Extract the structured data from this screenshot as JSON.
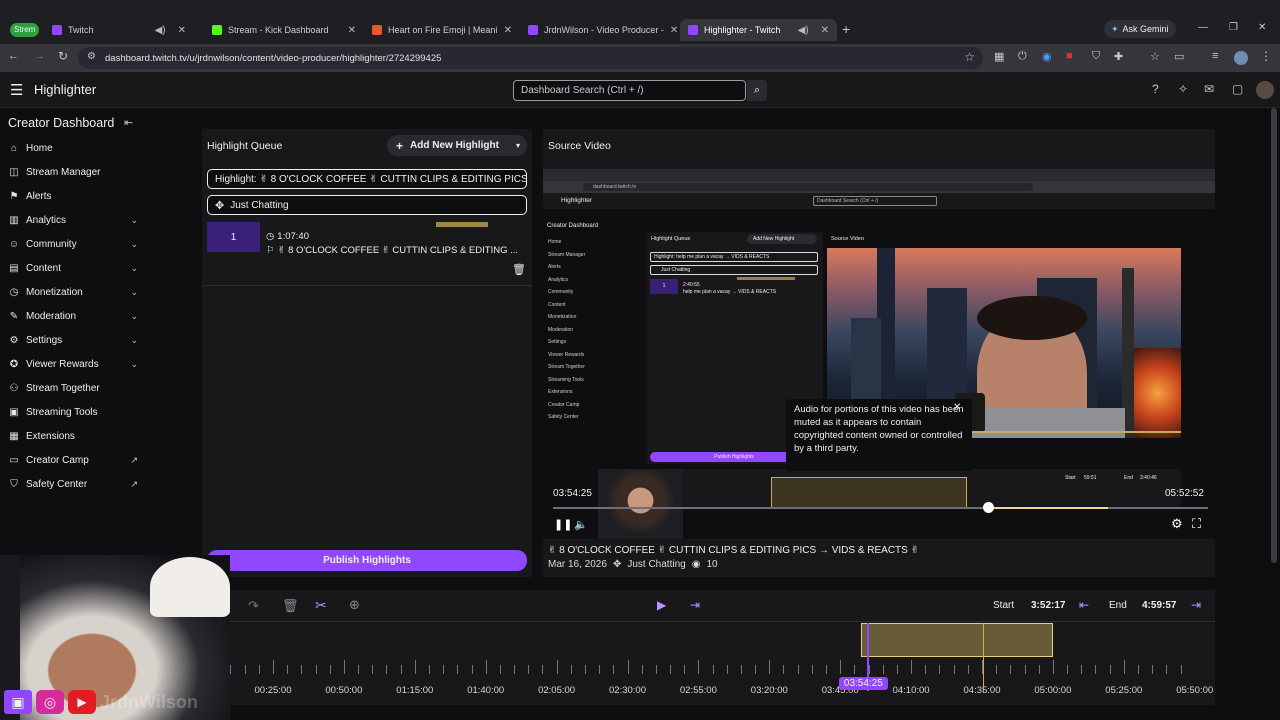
{
  "browser": {
    "profile_badge": "Strem",
    "tabs": [
      {
        "title": "Twitch",
        "color": "#9147ff"
      },
      {
        "title": "Stream - Kick Dashboard",
        "color": "#53fc18"
      },
      {
        "title": "Heart on Fire Emoji | Meani",
        "color": "#e55b2d"
      },
      {
        "title": "JrdnWilson - Video Producer -",
        "color": "#9147ff"
      },
      {
        "title": "Highlighter - Twitch",
        "color": "#9147ff"
      }
    ],
    "ask_gemini": "Ask Gemini",
    "url": "dashboard.twitch.tv/u/jrdnwilson/content/video-producer/highlighter/2724299425"
  },
  "header": {
    "title": "Highlighter",
    "search_placeholder": "Dashboard Search (Ctrl + /)"
  },
  "sidebar": {
    "title": "Creator Dashboard",
    "items": [
      {
        "label": "Home",
        "icon": "home-icon",
        "glyph": "⌂"
      },
      {
        "label": "Stream Manager",
        "icon": "stream-manager-icon",
        "glyph": "◫"
      },
      {
        "label": "Alerts",
        "icon": "alerts-icon",
        "glyph": "⚑"
      },
      {
        "label": "Analytics",
        "icon": "analytics-icon",
        "glyph": "▥"
      },
      {
        "label": "Community",
        "icon": "community-icon",
        "glyph": "☺"
      },
      {
        "label": "Content",
        "icon": "content-icon",
        "glyph": "▤"
      },
      {
        "label": "Monetization",
        "icon": "monetization-icon",
        "glyph": "◷"
      },
      {
        "label": "Moderation",
        "icon": "moderation-icon",
        "glyph": "✎"
      },
      {
        "label": "Settings",
        "icon": "settings-icon",
        "glyph": "⚙"
      },
      {
        "label": "Viewer Rewards",
        "icon": "rewards-icon",
        "glyph": "✪"
      },
      {
        "label": "Stream Together",
        "icon": "stream-together-icon",
        "glyph": "⚇"
      },
      {
        "label": "Streaming Tools",
        "icon": "streaming-tools-icon",
        "glyph": "▣"
      },
      {
        "label": "Extensions",
        "icon": "extensions-icon",
        "glyph": "▦"
      },
      {
        "label": "Creator Camp",
        "icon": "creator-camp-icon",
        "glyph": "▭"
      },
      {
        "label": "Safety Center",
        "icon": "safety-icon",
        "glyph": "⛉"
      }
    ]
  },
  "queue": {
    "title": "Highlight Queue",
    "add_label": "Add New Highlight",
    "highlight_title": "Highlight: ✌ 8 O'CLOCK COFFEE ✌ CUTTIN CLIPS & EDITING PICS →",
    "category": "Just Chatting",
    "item": {
      "index": "1",
      "duration": "1:07:40",
      "title": "✌ 8 O'CLOCK COFFEE ✌ CUTTIN CLIPS & EDITING ..."
    },
    "publish_label": "Publish Highlights"
  },
  "source": {
    "title": "Source Video",
    "time_current": "03:54:25",
    "time_end": "05:52:52",
    "muted_notice": "Audio for portions of this video has been muted as it appears to contain copyrighted content owned or controlled by a third party.",
    "video_title": "✌ 8 O'CLOCK COFFEE ✌ CUTTIN CLIPS & EDITING PICS → VIDS & REACTS ✌",
    "date": "Mar 16, 2026",
    "category": "Just Chatting",
    "views": "10"
  },
  "inner_shot": {
    "title": "Highlighter",
    "search": "Dashboard Search (Ctrl + /)",
    "creator": "Creator Dashboard",
    "queue": "Highlight Queue",
    "add": "Add New Highlight",
    "source": "Source Video",
    "highlight": "Highlight: help me plan a vacay → VIDS & REACTS",
    "cat": "Just Chatting",
    "dur": "2:40:55",
    "item": "help me plan a vacay → VIDS & REACTS",
    "publish": "Publish Highlights",
    "start_label": "Start",
    "start": "59:51",
    "end_label": "End",
    "end": "3:40:46",
    "nav": [
      "Home",
      "Stream Manager",
      "Alerts",
      "Analytics",
      "Community",
      "Content",
      "Monetization",
      "Moderation",
      "Settings",
      "Viewer Rewards",
      "Stream Together",
      "Streaming Tools",
      "Extensions",
      "Creator Camp",
      "Safety Center"
    ]
  },
  "timeline": {
    "start_label": "Start",
    "start": "3:52:17",
    "end_label": "End",
    "end": "4:59:57",
    "playhead": "03:54:25",
    "ticks": [
      "00:25:00",
      "00:50:00",
      "01:15:00",
      "01:40:00",
      "02:05:00",
      "02:30:00",
      "02:55:00",
      "03:20:00",
      "03:45:00",
      "04:10:00",
      "04:35:00",
      "05:00:00",
      "05:25:00",
      "05:50:00"
    ]
  },
  "colors": {
    "accent": "#9147ff",
    "highlight": "#c9ac5a"
  },
  "watermark": "JrdnWilson"
}
